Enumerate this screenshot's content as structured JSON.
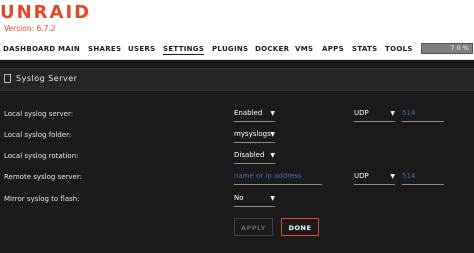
{
  "header": {
    "logo": "UNRAID",
    "version": "Version: 6.7.2"
  },
  "nav": {
    "items": [
      {
        "id": "dashboard",
        "label": "DASHBOARD"
      },
      {
        "id": "main",
        "label": "MAIN"
      },
      {
        "id": "shares",
        "label": "SHARES"
      },
      {
        "id": "users",
        "label": "USERS"
      },
      {
        "id": "settings",
        "label": "SETTINGS"
      },
      {
        "id": "plugins",
        "label": "PLUGINS"
      },
      {
        "id": "docker",
        "label": "DOCKER"
      },
      {
        "id": "vms",
        "label": "VMS"
      },
      {
        "id": "apps",
        "label": "APPS"
      },
      {
        "id": "stats",
        "label": "STATS"
      },
      {
        "id": "tools",
        "label": "TOOLS"
      }
    ],
    "active": "SETTINGS",
    "utilization": "7 0 %",
    "utilization_fraction": 0.7
  },
  "section": {
    "title": "Syslog Server"
  },
  "form": {
    "local_server": {
      "label": "Local syslog server:",
      "value": "Enabled",
      "protocol": "UDP",
      "port": "514"
    },
    "local_folder": {
      "label": "Local syslog folder:",
      "value": "mysyslogs"
    },
    "local_rotation": {
      "label": "Local syslog rotation:",
      "value": "Disabled"
    },
    "remote_server": {
      "label": "Remote syslog server:",
      "placeholder": "name or ip address",
      "protocol": "UDP",
      "port": "514"
    },
    "mirror_flash": {
      "label": "Mirror syslog to flash:",
      "value": "No"
    }
  },
  "buttons": {
    "apply": "APPLY",
    "done": "DONE"
  },
  "colors": {
    "accent": "#e8462b",
    "link": "#486dba",
    "background": "#1c1b1b"
  }
}
